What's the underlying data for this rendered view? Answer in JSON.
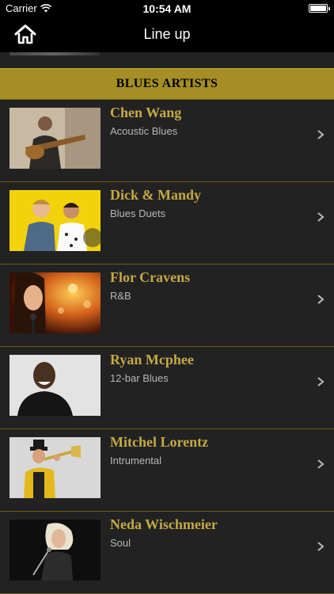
{
  "status_bar": {
    "carrier": "Carrier",
    "time": "10:54 AM"
  },
  "nav": {
    "title": "Line up",
    "home_icon": "home-icon"
  },
  "section": {
    "title": "BLUES ARTISTS"
  },
  "colors": {
    "accent_gold": "#a58f25",
    "name_gold": "#c5a944",
    "row_bg": "#222222"
  },
  "artists": [
    {
      "name": "Chen Wang",
      "genre": "Acoustic Blues"
    },
    {
      "name": "Dick & Mandy",
      "genre": "Blues Duets"
    },
    {
      "name": "Flor Cravens",
      "genre": "R&B"
    },
    {
      "name": "Ryan Mcphee",
      "genre": "12-bar Blues"
    },
    {
      "name": "Mitchel Lorentz",
      "genre": "Intrumental"
    },
    {
      "name": "Neda Wischmeier",
      "genre": "Soul"
    }
  ]
}
